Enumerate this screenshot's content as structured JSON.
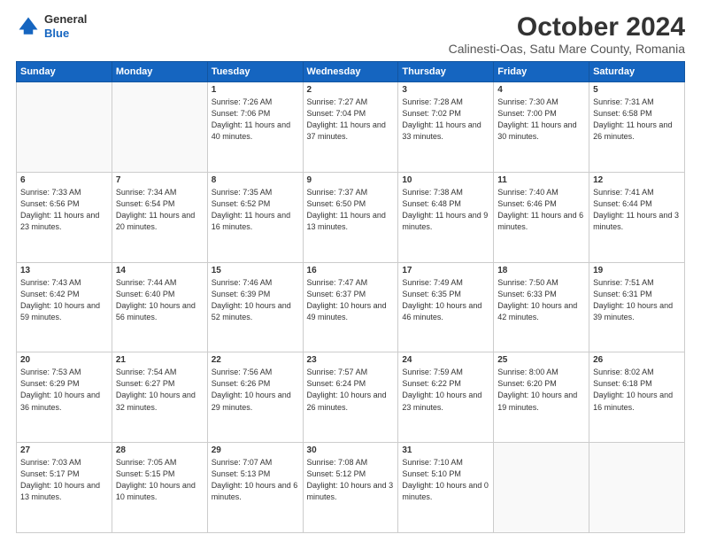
{
  "header": {
    "logo_line1": "General",
    "logo_line2": "Blue",
    "title": "October 2024",
    "subtitle": "Calinesti-Oas, Satu Mare County, Romania"
  },
  "days_of_week": [
    "Sunday",
    "Monday",
    "Tuesday",
    "Wednesday",
    "Thursday",
    "Friday",
    "Saturday"
  ],
  "weeks": [
    [
      {
        "day": "",
        "text": ""
      },
      {
        "day": "",
        "text": ""
      },
      {
        "day": "1",
        "text": "Sunrise: 7:26 AM\nSunset: 7:06 PM\nDaylight: 11 hours and 40 minutes."
      },
      {
        "day": "2",
        "text": "Sunrise: 7:27 AM\nSunset: 7:04 PM\nDaylight: 11 hours and 37 minutes."
      },
      {
        "day": "3",
        "text": "Sunrise: 7:28 AM\nSunset: 7:02 PM\nDaylight: 11 hours and 33 minutes."
      },
      {
        "day": "4",
        "text": "Sunrise: 7:30 AM\nSunset: 7:00 PM\nDaylight: 11 hours and 30 minutes."
      },
      {
        "day": "5",
        "text": "Sunrise: 7:31 AM\nSunset: 6:58 PM\nDaylight: 11 hours and 26 minutes."
      }
    ],
    [
      {
        "day": "6",
        "text": "Sunrise: 7:33 AM\nSunset: 6:56 PM\nDaylight: 11 hours and 23 minutes."
      },
      {
        "day": "7",
        "text": "Sunrise: 7:34 AM\nSunset: 6:54 PM\nDaylight: 11 hours and 20 minutes."
      },
      {
        "day": "8",
        "text": "Sunrise: 7:35 AM\nSunset: 6:52 PM\nDaylight: 11 hours and 16 minutes."
      },
      {
        "day": "9",
        "text": "Sunrise: 7:37 AM\nSunset: 6:50 PM\nDaylight: 11 hours and 13 minutes."
      },
      {
        "day": "10",
        "text": "Sunrise: 7:38 AM\nSunset: 6:48 PM\nDaylight: 11 hours and 9 minutes."
      },
      {
        "day": "11",
        "text": "Sunrise: 7:40 AM\nSunset: 6:46 PM\nDaylight: 11 hours and 6 minutes."
      },
      {
        "day": "12",
        "text": "Sunrise: 7:41 AM\nSunset: 6:44 PM\nDaylight: 11 hours and 3 minutes."
      }
    ],
    [
      {
        "day": "13",
        "text": "Sunrise: 7:43 AM\nSunset: 6:42 PM\nDaylight: 10 hours and 59 minutes."
      },
      {
        "day": "14",
        "text": "Sunrise: 7:44 AM\nSunset: 6:40 PM\nDaylight: 10 hours and 56 minutes."
      },
      {
        "day": "15",
        "text": "Sunrise: 7:46 AM\nSunset: 6:39 PM\nDaylight: 10 hours and 52 minutes."
      },
      {
        "day": "16",
        "text": "Sunrise: 7:47 AM\nSunset: 6:37 PM\nDaylight: 10 hours and 49 minutes."
      },
      {
        "day": "17",
        "text": "Sunrise: 7:49 AM\nSunset: 6:35 PM\nDaylight: 10 hours and 46 minutes."
      },
      {
        "day": "18",
        "text": "Sunrise: 7:50 AM\nSunset: 6:33 PM\nDaylight: 10 hours and 42 minutes."
      },
      {
        "day": "19",
        "text": "Sunrise: 7:51 AM\nSunset: 6:31 PM\nDaylight: 10 hours and 39 minutes."
      }
    ],
    [
      {
        "day": "20",
        "text": "Sunrise: 7:53 AM\nSunset: 6:29 PM\nDaylight: 10 hours and 36 minutes."
      },
      {
        "day": "21",
        "text": "Sunrise: 7:54 AM\nSunset: 6:27 PM\nDaylight: 10 hours and 32 minutes."
      },
      {
        "day": "22",
        "text": "Sunrise: 7:56 AM\nSunset: 6:26 PM\nDaylight: 10 hours and 29 minutes."
      },
      {
        "day": "23",
        "text": "Sunrise: 7:57 AM\nSunset: 6:24 PM\nDaylight: 10 hours and 26 minutes."
      },
      {
        "day": "24",
        "text": "Sunrise: 7:59 AM\nSunset: 6:22 PM\nDaylight: 10 hours and 23 minutes."
      },
      {
        "day": "25",
        "text": "Sunrise: 8:00 AM\nSunset: 6:20 PM\nDaylight: 10 hours and 19 minutes."
      },
      {
        "day": "26",
        "text": "Sunrise: 8:02 AM\nSunset: 6:18 PM\nDaylight: 10 hours and 16 minutes."
      }
    ],
    [
      {
        "day": "27",
        "text": "Sunrise: 7:03 AM\nSunset: 5:17 PM\nDaylight: 10 hours and 13 minutes."
      },
      {
        "day": "28",
        "text": "Sunrise: 7:05 AM\nSunset: 5:15 PM\nDaylight: 10 hours and 10 minutes."
      },
      {
        "day": "29",
        "text": "Sunrise: 7:07 AM\nSunset: 5:13 PM\nDaylight: 10 hours and 6 minutes."
      },
      {
        "day": "30",
        "text": "Sunrise: 7:08 AM\nSunset: 5:12 PM\nDaylight: 10 hours and 3 minutes."
      },
      {
        "day": "31",
        "text": "Sunrise: 7:10 AM\nSunset: 5:10 PM\nDaylight: 10 hours and 0 minutes."
      },
      {
        "day": "",
        "text": ""
      },
      {
        "day": "",
        "text": ""
      }
    ]
  ]
}
